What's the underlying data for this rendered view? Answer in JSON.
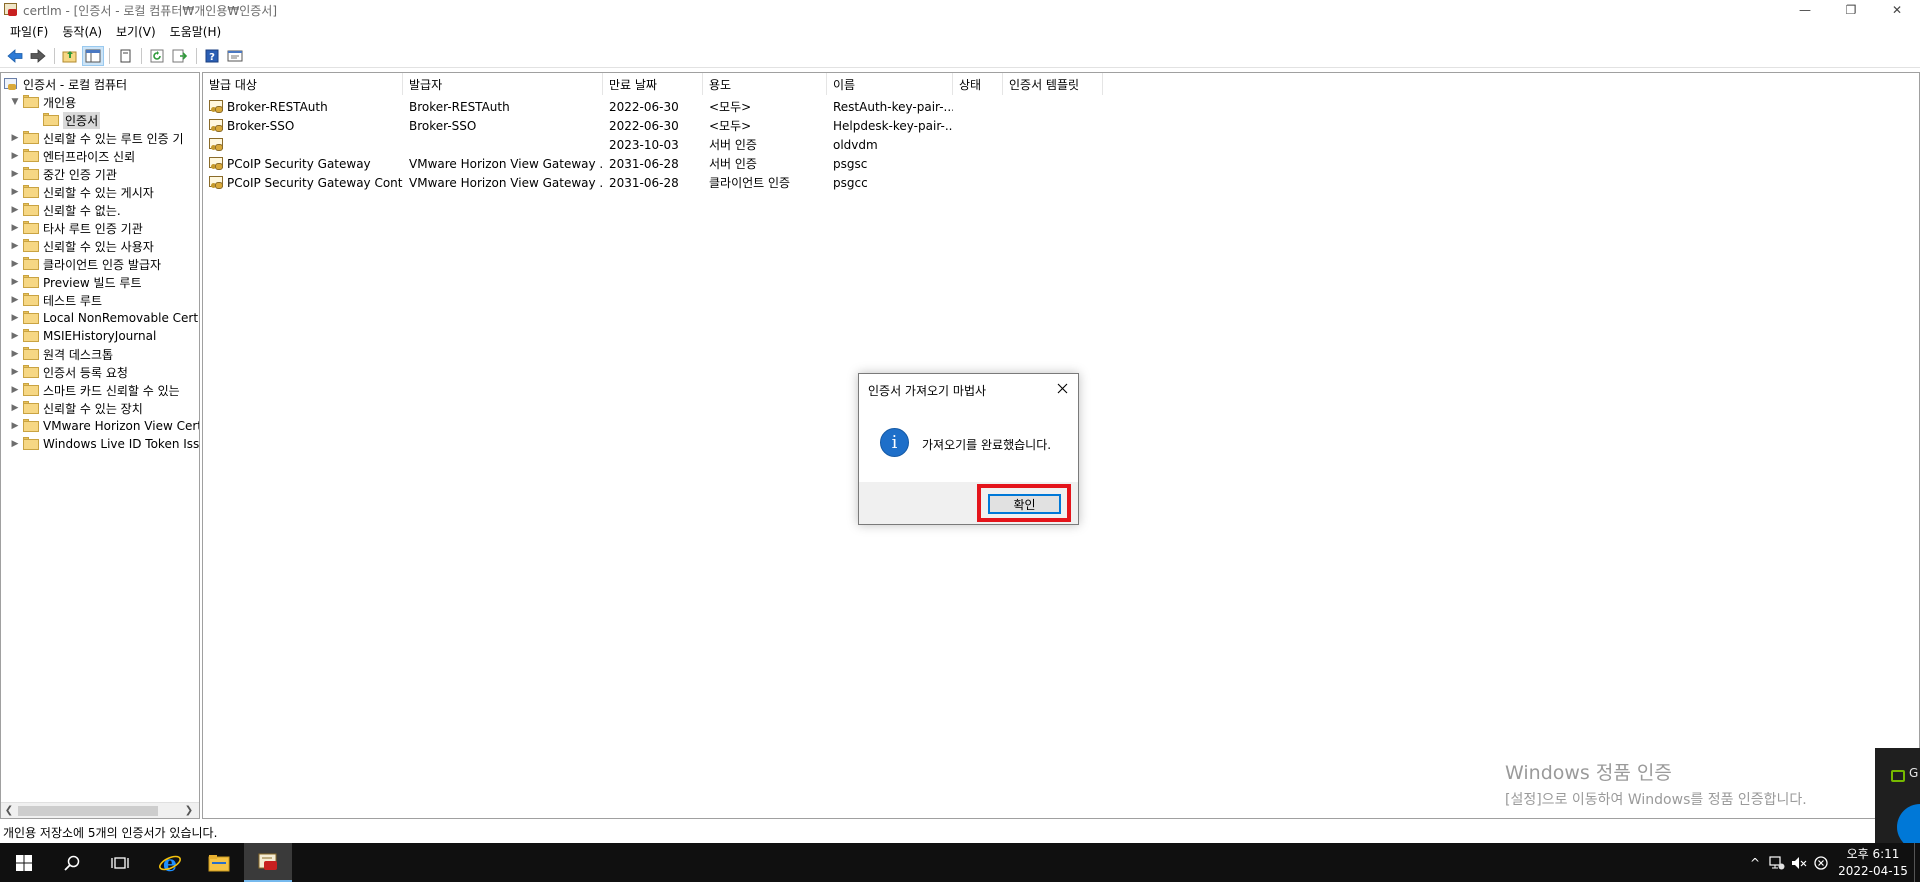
{
  "window": {
    "title": "certlm - [인증서 - 로컬 컴퓨터₩개인용₩인증서]",
    "controls": {
      "minimize": "—",
      "restore": "❐",
      "close": "✕"
    }
  },
  "menu": [
    "파일(F)",
    "동작(A)",
    "보기(V)",
    "도움말(H)"
  ],
  "toolbar_icons": [
    "back-arrow-icon",
    "forward-arrow-icon",
    "up-folder-icon",
    "show-hide-tree-icon",
    "delete-icon",
    "refresh-icon",
    "export-list-icon",
    "help-icon",
    "properties-icon"
  ],
  "tree": {
    "root": "인증서 - 로컬 컴퓨터",
    "personal": "개인용",
    "personal_child": "인증서",
    "items": [
      "신뢰할 수 있는 루트 인증 기",
      "엔터프라이즈 신뢰",
      "중간 인증 기관",
      "신뢰할 수 있는 게시자",
      "신뢰할 수 없는.",
      "타사 루트 인증 기관",
      "신뢰할 수 있는 사용자",
      "클라이언트 인증 발급자",
      "Preview 빌드 루트",
      "테스트 루트",
      "Local NonRemovable Certific",
      "MSIEHistoryJournal",
      "원격 데스크톱",
      "인증서 등록 요청",
      "스마트 카드 신뢰할 수 있는",
      "신뢰할 수 있는 장치",
      "VMware Horizon View Certif",
      "Windows Live ID Token Issue"
    ]
  },
  "list": {
    "columns": [
      "발급 대상",
      "발급자",
      "만료 날짜",
      "용도",
      "이름",
      "상태",
      "인증서 템플릿"
    ],
    "sort_indicator": "^",
    "rows": [
      [
        "Broker-RESTAuth",
        "Broker-RESTAuth",
        "2022-06-30",
        "<모두>",
        "RestAuth-key-pair-...",
        "",
        ""
      ],
      [
        "Broker-SSO",
        "Broker-SSO",
        "2022-06-30",
        "<모두>",
        "Helpdesk-key-pair-...",
        "",
        ""
      ],
      [
        "",
        "",
        "2023-10-03",
        "서버 인증",
        "oldvdm",
        "",
        ""
      ],
      [
        "PCoIP Security Gateway",
        "VMware Horizon View Gateway ...",
        "2031-06-28",
        "서버 인증",
        "psgsc",
        "",
        ""
      ],
      [
        "PCoIP Security Gateway Contr...",
        "VMware Horizon View Gateway ...",
        "2031-06-28",
        "클라이언트 인증",
        "psgcc",
        "",
        ""
      ]
    ]
  },
  "status_bar": "개인용 저장소에 5개의 인증서가 있습니다.",
  "dialog": {
    "title": "인증서 가져오기 마법사",
    "message": "가져오기를 완료했습니다.",
    "ok_label": "확인",
    "info_glyph": "i",
    "highlight_color": "#e4141b"
  },
  "watermark": {
    "line1": "Windows 정품 인증",
    "line2": "[설정]으로 이동하여 Windows를 정품 인증합니다."
  },
  "notification": {
    "text": "G"
  },
  "taskbar": {
    "apps": [
      "start-icon",
      "search-icon",
      "task-view-icon",
      "internet-explorer-icon",
      "file-explorer-icon",
      "certlm-icon"
    ],
    "tray": {
      "chevron": "^",
      "clock_time": "오후 6:11",
      "clock_date": "2022-04-15"
    }
  },
  "colors": {
    "accent": "#0078d7",
    "taskbar": "#101010"
  }
}
